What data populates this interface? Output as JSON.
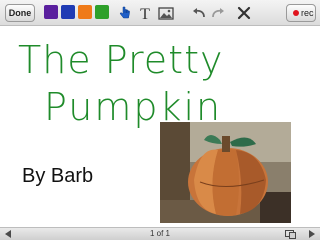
{
  "toolbar": {
    "done_label": "Done",
    "colors": [
      "#5a1f9e",
      "#1f3bb4",
      "#ef7a18",
      "#2ea02a"
    ],
    "tools": [
      "pointer-icon",
      "text-icon",
      "image-icon",
      "undo-icon",
      "redo-icon",
      "clear-icon"
    ],
    "rec_label": "rec"
  },
  "canvas": {
    "title_line1": "The Pretty",
    "title_line2": "Pumpkin",
    "title_color": "#1f8b2a",
    "author": "By Barb"
  },
  "footer": {
    "page_indicator": "1 of 1"
  }
}
